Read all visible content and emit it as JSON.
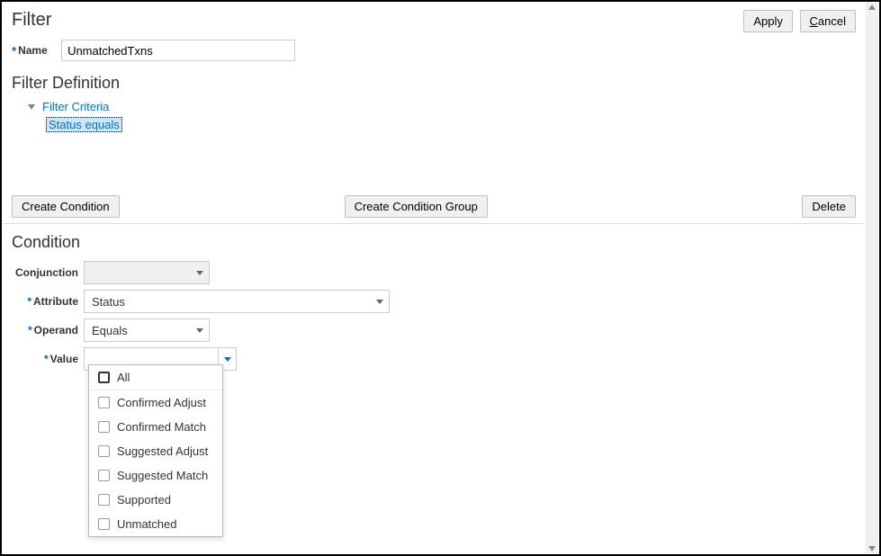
{
  "header": {
    "title": "Filter",
    "apply": "Apply",
    "cancel": "Cancel",
    "cancel_key": "C"
  },
  "name_field": {
    "label": "Name",
    "value": "UnmatchedTxns"
  },
  "definition": {
    "title": "Filter Definition",
    "root": "Filter Criteria",
    "node": "Status equals"
  },
  "actions": {
    "create_condition": "Create Condition",
    "create_group": "Create Condition Group",
    "delete": "Delete"
  },
  "condition": {
    "title": "Condition",
    "labels": {
      "conjunction": "Conjunction",
      "attribute": "Attribute",
      "operand": "Operand",
      "value": "Value"
    },
    "values": {
      "conjunction": "",
      "attribute": "Status",
      "operand": "Equals",
      "value": ""
    }
  },
  "value_dropdown": {
    "options": [
      "All",
      "Confirmed Adjust",
      "Confirmed Match",
      "Suggested Adjust",
      "Suggested Match",
      "Supported",
      "Unmatched"
    ]
  }
}
